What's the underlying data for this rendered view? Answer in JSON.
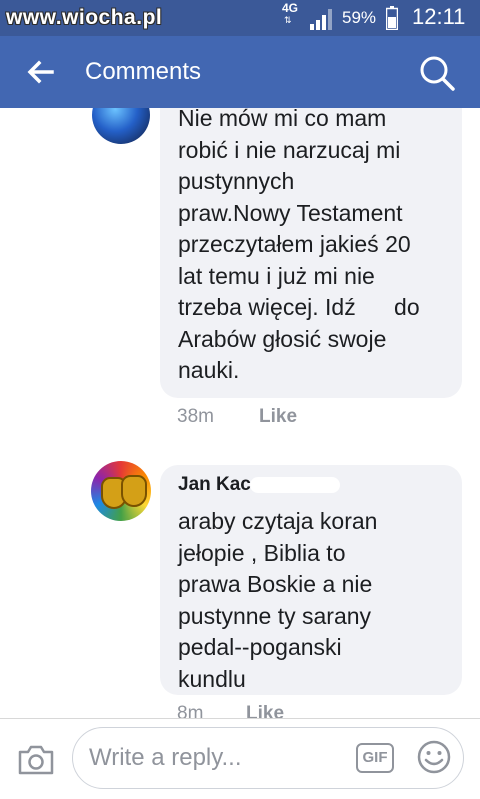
{
  "status_bar": {
    "watermark": "www.wiocha.pl",
    "network": "4G",
    "network_arrows": "⇅",
    "battery": "59%",
    "time": "12:11"
  },
  "app_bar": {
    "title": "Comments"
  },
  "comments": [
    {
      "author": "",
      "lines": [
        "Nie mów mi co mam",
        "robić i nie narzucaj mi",
        "pustynnych",
        "praw.Nowy Testament",
        "przeczytałem jakieś 20",
        "lat temu i już mi nie",
        "trzeba więcej. Idź      do",
        "Arabów głosić swoje",
        "nauki."
      ],
      "time": "38m",
      "like": "Like"
    },
    {
      "author": "Jan Kac",
      "lines": [
        "araby czytaja koran",
        "jełopie , Biblia to",
        "prawa Boskie a nie",
        "pustynne ty sarany",
        "pedal--poganski",
        "kundlu"
      ],
      "time": "8m",
      "like": "Like"
    }
  ],
  "reply": {
    "placeholder": "Write a reply...",
    "gif_label": "GIF"
  },
  "colors": {
    "status_bar": "#3b5998",
    "app_bar": "#4267b2",
    "bubble": "#f1f2f6",
    "meta": "#90949c"
  },
  "icons": [
    "back-arrow-icon",
    "search-icon",
    "camera-icon",
    "gif-icon",
    "emoji-icon"
  ]
}
